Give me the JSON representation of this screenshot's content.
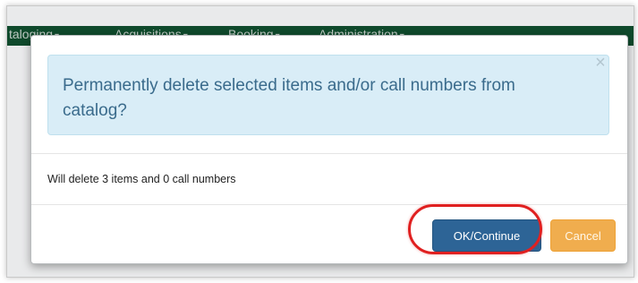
{
  "nav": {
    "items": [
      {
        "label": "taloging",
        "caret": "▾"
      },
      {
        "label": "Acquisitions",
        "caret": "▾"
      },
      {
        "label": "Booking",
        "caret": "▾"
      },
      {
        "label": "Administration",
        "caret": "▾"
      }
    ]
  },
  "modal": {
    "close_glyph": "×",
    "alert_message": "Permanently delete selected items and/or call numbers from catalog?",
    "body_text": "Will delete 3 items and 0 call numbers",
    "ok_label": "OK/Continue",
    "cancel_label": "Cancel"
  },
  "annotation": {
    "highlight_color": "#e02020"
  },
  "colors": {
    "nav_bg": "#0f4a2c",
    "alert_bg": "#d9edf7",
    "primary": "#2d6496",
    "warning": "#f0ad4e"
  }
}
